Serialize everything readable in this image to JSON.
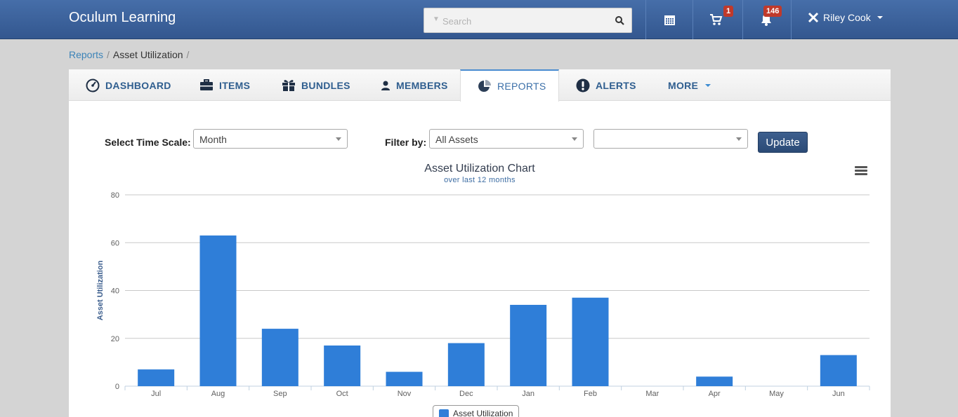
{
  "app": {
    "brand": "Oculum Learning",
    "search": {
      "placeholder": "Search"
    },
    "cart_badge": "1",
    "alerts_badge": "146",
    "user_name": "Riley Cook"
  },
  "breadcrumb": {
    "items": [
      "Reports",
      "Asset Utilization"
    ]
  },
  "tabs": [
    {
      "label": "DASHBOARD",
      "icon": "dashboard-icon"
    },
    {
      "label": "ITEMS",
      "icon": "briefcase-icon"
    },
    {
      "label": "BUNDLES",
      "icon": "gift-icon"
    },
    {
      "label": "MEMBERS",
      "icon": "user-icon"
    },
    {
      "label": "REPORTS",
      "icon": "pie-chart-icon",
      "active": true
    },
    {
      "label": "ALERTS",
      "icon": "exclamation-icon"
    },
    {
      "label": "MORE",
      "icon": "chevron-down-icon"
    }
  ],
  "controls": {
    "time_scale_label": "Select Time Scale:",
    "time_scale_value": "Month",
    "filter_label": "Filter by:",
    "filter_value": "All Assets",
    "filter2_value": "",
    "update_label": "Update"
  },
  "colors": {
    "bar": "#2f7ed8",
    "navbar": "#3a62a0"
  },
  "chart_data": {
    "type": "bar",
    "title": "Asset Utilization Chart",
    "subtitle": "over last 12 months",
    "ylabel": "Asset Utilization",
    "ylim": [
      0,
      80
    ],
    "yticks": [
      0,
      20,
      40,
      60,
      80
    ],
    "categories": [
      "Jul",
      "Aug",
      "Sep",
      "Oct",
      "Nov",
      "Dec",
      "Jan",
      "Feb",
      "Mar",
      "Apr",
      "May",
      "Jun"
    ],
    "series": [
      {
        "name": "Asset Utilization",
        "values": [
          7,
          63,
          24,
          17,
          6,
          18,
          34,
          37,
          0,
          4,
          0,
          13
        ]
      }
    ],
    "grid": true,
    "legend": "bottom-center"
  }
}
